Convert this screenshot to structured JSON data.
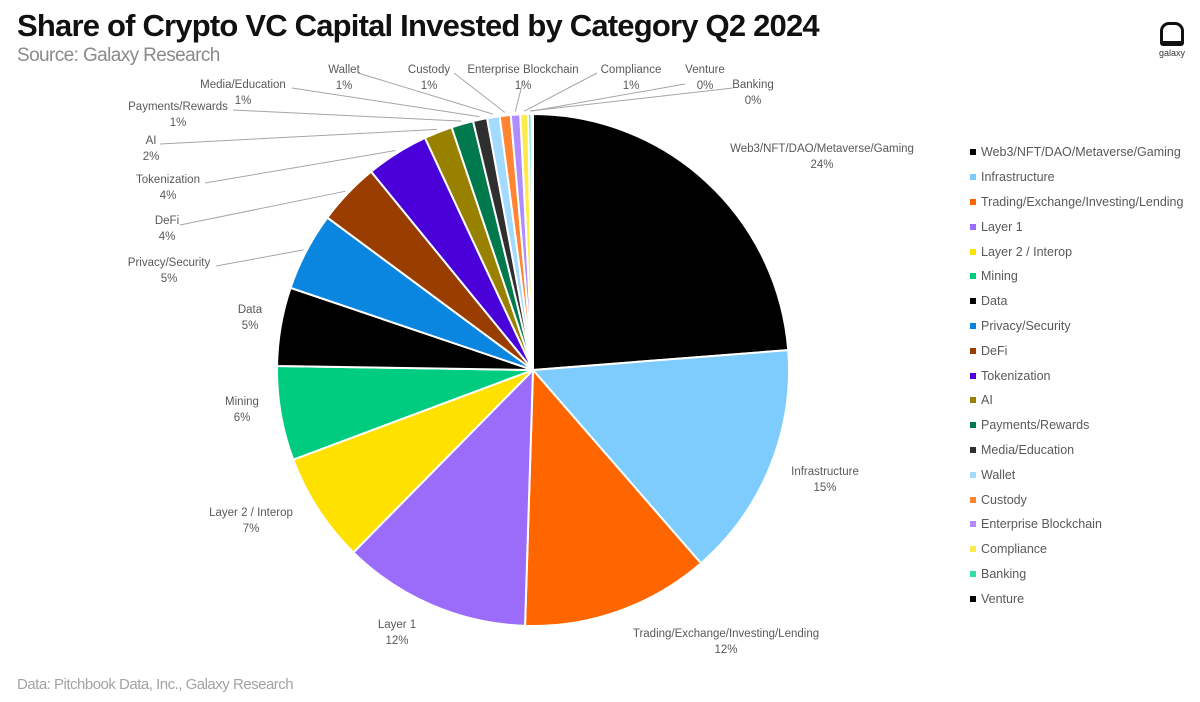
{
  "header": {
    "title": "Share of Crypto VC Capital Invested by Category Q2 2024",
    "subtitle": "Source: Galaxy Research",
    "logo_text": "galaxy"
  },
  "footer": {
    "source": "Data: Pitchbook Data, Inc., Galaxy Research"
  },
  "chart_data": {
    "type": "pie",
    "title": "Share of Crypto VC Capital Invested by Category Q2 2024",
    "legend_position": "right",
    "start": "top, clockwise",
    "slices": [
      {
        "name": "Web3/NFT/DAO/Metaverse/Gaming",
        "value": 24,
        "label": "24%",
        "color": "#000000"
      },
      {
        "name": "Infrastructure",
        "value": 15,
        "label": "15%",
        "color": "#7ecbfd"
      },
      {
        "name": "Trading/Exchange/Investing/Lending",
        "value": 12,
        "label": "12%",
        "color": "#ff6600"
      },
      {
        "name": "Layer 1",
        "value": 12,
        "label": "12%",
        "color": "#9b6bfa"
      },
      {
        "name": "Layer 2 / Interop",
        "value": 7,
        "label": "7%",
        "color": "#ffe100"
      },
      {
        "name": "Mining",
        "value": 6,
        "label": "6%",
        "color": "#00cc7f"
      },
      {
        "name": "Data",
        "value": 5,
        "label": "5%",
        "color": "#000000"
      },
      {
        "name": "Privacy/Security",
        "value": 5,
        "label": "5%",
        "color": "#0a86e0"
      },
      {
        "name": "DeFi",
        "value": 4,
        "label": "4%",
        "color": "#993d00"
      },
      {
        "name": "Tokenization",
        "value": 4,
        "label": "4%",
        "color": "#4a00d9"
      },
      {
        "name": "AI",
        "value": 1.8,
        "label": "2%",
        "color": "#998100"
      },
      {
        "name": "Payments/Rewards",
        "value": 1.4,
        "label": "1%",
        "color": "#007a4d"
      },
      {
        "name": "Media/Education",
        "value": 0.9,
        "label": "1%",
        "color": "#2f2f2f"
      },
      {
        "name": "Wallet",
        "value": 0.8,
        "label": "1%",
        "color": "#a3daff"
      },
      {
        "name": "Custody",
        "value": 0.7,
        "label": "1%",
        "color": "#ff8533"
      },
      {
        "name": "Enterprise Blockchain",
        "value": 0.6,
        "label": "1%",
        "color": "#b08cff"
      },
      {
        "name": "Compliance",
        "value": 0.5,
        "label": "1%",
        "color": "#ffea4d"
      },
      {
        "name": "Banking",
        "value": 0.2,
        "label": "0%",
        "color": "#33e0a0"
      },
      {
        "name": "Venture",
        "value": 0.1,
        "label": "0%",
        "color": "#000000"
      }
    ]
  }
}
